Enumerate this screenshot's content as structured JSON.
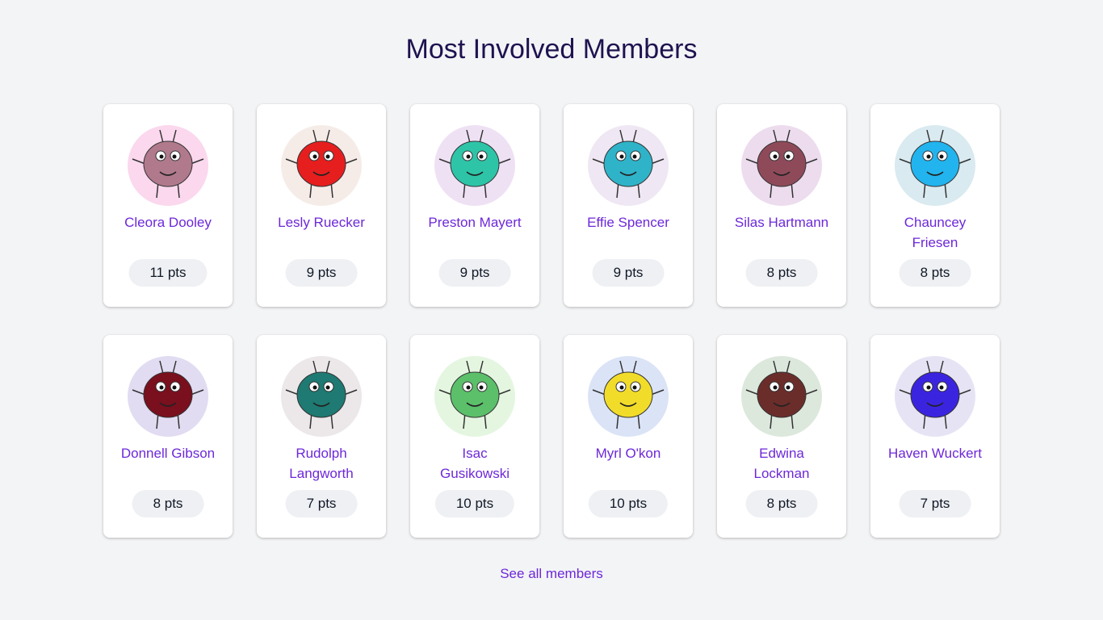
{
  "page": {
    "title": "Most Involved Members",
    "see_all_label": "See all members"
  },
  "colors": {
    "background": "#f3f4f6",
    "title": "#1e1250",
    "link": "#6d28d9",
    "badge_bg": "#eef0f3"
  },
  "members": [
    {
      "name": "Cleora Dooley",
      "points": "11 pts",
      "avatar": "monster-avatar",
      "bg": "#fbd8ee",
      "body": "#b07a8c"
    },
    {
      "name": "Lesly Ruecker",
      "points": "9 pts",
      "avatar": "monster-avatar",
      "bg": "#f5ece8",
      "body": "#e61e1e"
    },
    {
      "name": "Preston Mayert",
      "points": "9 pts",
      "avatar": "monster-avatar",
      "bg": "#efe1f4",
      "body": "#2ec4a8"
    },
    {
      "name": "Effie Spencer",
      "points": "9 pts",
      "avatar": "monster-avatar",
      "bg": "#efe7f3",
      "body": "#2fb3c9"
    },
    {
      "name": "Silas Hartmann",
      "points": "8 pts",
      "avatar": "monster-avatar",
      "bg": "#ecdcee",
      "body": "#8f4a5a"
    },
    {
      "name": "Chauncey Friesen",
      "points": "8 pts",
      "avatar": "monster-avatar",
      "bg": "#d9eaf0",
      "body": "#22b4ee"
    },
    {
      "name": "Donnell Gibson",
      "points": "8 pts",
      "avatar": "monster-avatar",
      "bg": "#e2dcf2",
      "body": "#7a0f1e"
    },
    {
      "name": "Rudolph Langworth",
      "points": "7 pts",
      "avatar": "monster-avatar",
      "bg": "#ece8ea",
      "body": "#1e7a72"
    },
    {
      "name": "Isac Gusikowski",
      "points": "10 pts",
      "avatar": "monster-avatar",
      "bg": "#e4f6e0",
      "body": "#5cbf6a"
    },
    {
      "name": "Myrl O'kon",
      "points": "10 pts",
      "avatar": "monster-avatar",
      "bg": "#dbe4f6",
      "body": "#f2dc2a"
    },
    {
      "name": "Edwina Lockman",
      "points": "8 pts",
      "avatar": "monster-avatar",
      "bg": "#dde8dd",
      "body": "#6b2d2a"
    },
    {
      "name": "Haven Wuckert",
      "points": "7 pts",
      "avatar": "monster-avatar",
      "bg": "#e6e4f4",
      "body": "#3b24e0"
    }
  ]
}
